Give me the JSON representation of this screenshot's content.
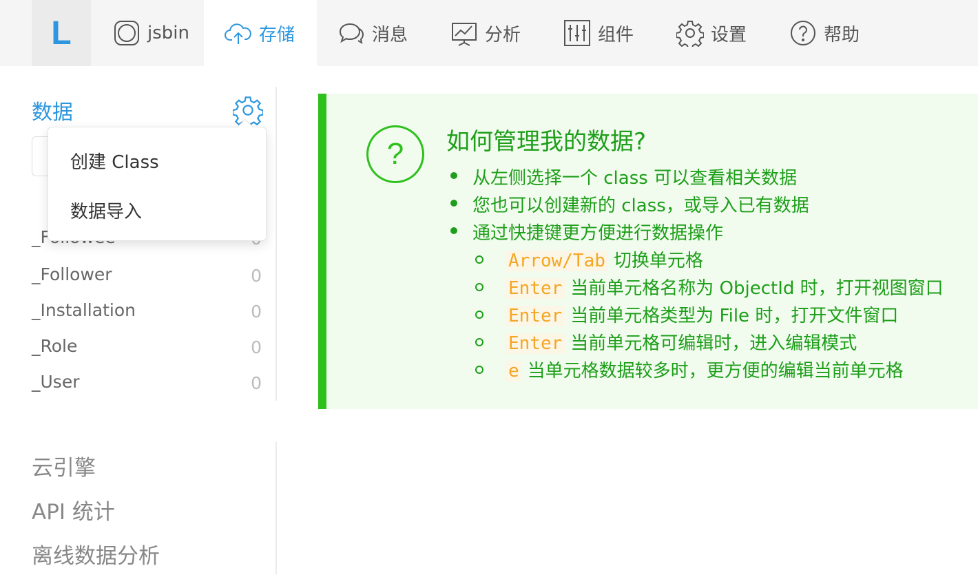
{
  "logo": "L",
  "nav": {
    "app_name": "jsbin",
    "items": [
      {
        "label": "存储",
        "icon": "cloud-upload-icon",
        "active": true
      },
      {
        "label": "消息",
        "icon": "chat-bubbles-icon"
      },
      {
        "label": "分析",
        "icon": "chart-icon"
      },
      {
        "label": "组件",
        "icon": "sliders-icon"
      },
      {
        "label": "设置",
        "icon": "gear-icon"
      },
      {
        "label": "帮助",
        "icon": "question-icon"
      }
    ]
  },
  "sidebar": {
    "heading": "数据",
    "classes": [
      {
        "name": "_Followee",
        "count": "0"
      },
      {
        "name": "_Follower",
        "count": "0"
      },
      {
        "name": "_Installation",
        "count": "0"
      },
      {
        "name": "_Role",
        "count": "0"
      },
      {
        "name": "_User",
        "count": "0"
      }
    ],
    "links": [
      "云引擎",
      "API 统计",
      "离线数据分析"
    ]
  },
  "dropdown": {
    "items": [
      "创建 Class",
      "数据导入"
    ]
  },
  "help": {
    "title": "如何管理我的数据?",
    "bullets": [
      "从左侧选择一个 class 可以查看相关数据",
      "您也可以创建新的 class，或导入已有数据",
      "通过快捷键更方便进行数据操作"
    ],
    "shortcuts": [
      {
        "key": "Arrow/Tab",
        "desc": "切换单元格"
      },
      {
        "key": "Enter",
        "desc": "当前单元格名称为 ObjectId 时，打开视图窗口"
      },
      {
        "key": "Enter",
        "desc": "当前单元格类型为 File 时，打开文件窗口"
      },
      {
        "key": "Enter",
        "desc": "当前单元格可编辑时，进入编辑模式"
      },
      {
        "key": "e",
        "desc": "当单元格数据较多时，更方便的编辑当前单元格"
      }
    ]
  },
  "colors": {
    "accent": "#2c97de",
    "success": "#2ec01d",
    "help_bg": "#f1fcee",
    "key": "#f5a623"
  }
}
